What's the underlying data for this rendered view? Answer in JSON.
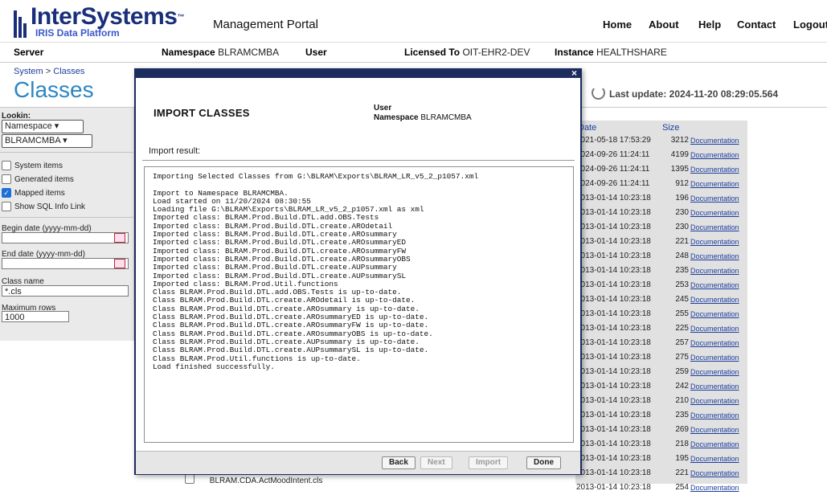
{
  "header": {
    "brand_name": "InterSystems",
    "brand_tm": "™",
    "brand_sub": "IRIS Data Platform",
    "portal_title": "Management Portal",
    "nav": [
      "Home",
      "About",
      "Help",
      "Contact",
      "Logout"
    ]
  },
  "infobar": {
    "server_label": "Server",
    "namespace_label": "Namespace",
    "namespace_value": "BLRAMCMBA",
    "user_label": "User",
    "licensed_label": "Licensed To",
    "licensed_value": "OIT-EHR2-DEV",
    "instance_label": "Instance",
    "instance_value": "HEALTHSHARE"
  },
  "breadcrumb": {
    "root": "System",
    "sep": ">",
    "current": "Classes"
  },
  "page_title": "Classes",
  "last_update": "Last update: 2024-11-20 08:29:05.564",
  "left": {
    "lookin_label": "Lookin:",
    "lookin_value": "Namespace",
    "namespace_value": "BLRAMCMBA",
    "checkboxes": [
      {
        "label": "System items",
        "checked": false
      },
      {
        "label": "Generated items",
        "checked": false
      },
      {
        "label": "Mapped items",
        "checked": true
      },
      {
        "label": "Show SQL Info Link",
        "checked": false
      }
    ],
    "begin_label": "Begin date (yyyy-mm-dd)",
    "end_label": "End date (yyyy-mm-dd)",
    "classname_label": "Class name",
    "classname_value": "*.cls",
    "maxrows_label": "Maximum rows",
    "maxrows_value": "1000"
  },
  "table": {
    "col_date": "Date",
    "col_size": "Size",
    "doc_label": "Documentation",
    "rows": [
      {
        "date": "2021-05-18 17:53:29",
        "size": "3212"
      },
      {
        "date": "2024-09-26 11:24:11",
        "size": "4199"
      },
      {
        "date": "2024-09-26 11:24:11",
        "size": "1395"
      },
      {
        "date": "2024-09-26 11:24:11",
        "size": "912"
      },
      {
        "date": "2013-01-14 10:23:18",
        "size": "196"
      },
      {
        "date": "2013-01-14 10:23:18",
        "size": "230"
      },
      {
        "date": "2013-01-14 10:23:18",
        "size": "230"
      },
      {
        "date": "2013-01-14 10:23:18",
        "size": "221"
      },
      {
        "date": "2013-01-14 10:23:18",
        "size": "248"
      },
      {
        "date": "2013-01-14 10:23:18",
        "size": "235"
      },
      {
        "date": "2013-01-14 10:23:18",
        "size": "253"
      },
      {
        "date": "2013-01-14 10:23:18",
        "size": "245"
      },
      {
        "date": "2013-01-14 10:23:18",
        "size": "255"
      },
      {
        "date": "2013-01-14 10:23:18",
        "size": "225"
      },
      {
        "date": "2013-01-14 10:23:18",
        "size": "257"
      },
      {
        "date": "2013-01-14 10:23:18",
        "size": "275"
      },
      {
        "date": "2013-01-14 10:23:18",
        "size": "259"
      },
      {
        "date": "2013-01-14 10:23:18",
        "size": "242"
      },
      {
        "date": "2013-01-14 10:23:18",
        "size": "210"
      },
      {
        "date": "2013-01-14 10:23:18",
        "size": "235"
      },
      {
        "date": "2013-01-14 10:23:18",
        "size": "269"
      },
      {
        "date": "2013-01-14 10:23:18",
        "size": "218"
      },
      {
        "date": "2013-01-14 10:23:18",
        "size": "195"
      },
      {
        "date": "2013-01-14 10:23:18",
        "size": "221"
      },
      {
        "date": "2013-01-14 10:23:18",
        "size": "254"
      }
    ],
    "bg_row_name": "BLRAM.CDA.ActMoodIntent.cls"
  },
  "modal": {
    "close": "×",
    "title": "IMPORT CLASSES",
    "user_label": "User",
    "namespace_label": "Namespace",
    "namespace_value": "BLRAMCMBA",
    "result_label": "Import result:",
    "result_text": "Importing Selected Classes from G:\\BLRAM\\Exports\\BLRAM_LR_v5_2_p1057.xml\n\nImport to Namespace BLRAMCMBA.\nLoad started on 11/20/2024 08:30:55\nLoading file G:\\BLRAM\\Exports\\BLRAM_LR_v5_2_p1057.xml as xml\nImported class: BLRAM.Prod.Build.DTL.add.OBS.Tests\nImported class: BLRAM.Prod.Build.DTL.create.AROdetail\nImported class: BLRAM.Prod.Build.DTL.create.AROsummary\nImported class: BLRAM.Prod.Build.DTL.create.AROsummaryED\nImported class: BLRAM.Prod.Build.DTL.create.AROsummaryFW\nImported class: BLRAM.Prod.Build.DTL.create.AROsummaryOBS\nImported class: BLRAM.Prod.Build.DTL.create.AUPsummary\nImported class: BLRAM.Prod.Build.DTL.create.AUPsummarySL\nImported class: BLRAM.Prod.Util.functions\nClass BLRAM.Prod.Build.DTL.add.OBS.Tests is up-to-date.\nClass BLRAM.Prod.Build.DTL.create.AROdetail is up-to-date.\nClass BLRAM.Prod.Build.DTL.create.AROsummary is up-to-date.\nClass BLRAM.Prod.Build.DTL.create.AROsummaryED is up-to-date.\nClass BLRAM.Prod.Build.DTL.create.AROsummaryFW is up-to-date.\nClass BLRAM.Prod.Build.DTL.create.AROsummaryOBS is up-to-date.\nClass BLRAM.Prod.Build.DTL.create.AUPsummary is up-to-date.\nClass BLRAM.Prod.Build.DTL.create.AUPsummarySL is up-to-date.\nClass BLRAM.Prod.Util.functions is up-to-date.\nLoad finished successfully.",
    "buttons": {
      "back": "Back",
      "next": "Next",
      "import": "Import",
      "done": "Done"
    }
  }
}
